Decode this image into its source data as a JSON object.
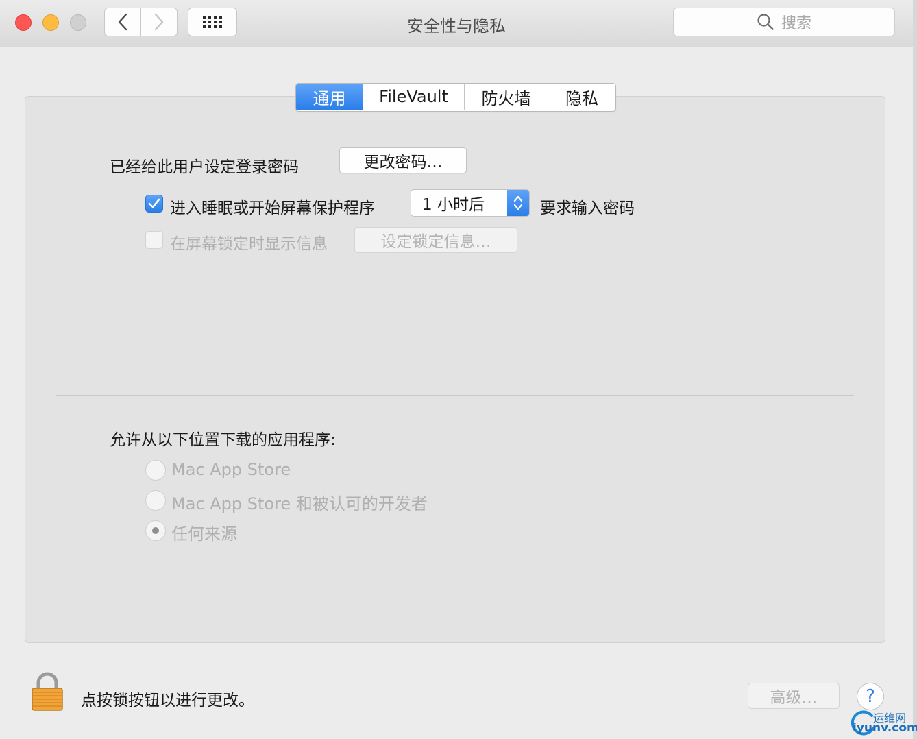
{
  "window": {
    "title": "安全性与隐私"
  },
  "toolbar": {
    "search_placeholder": "搜索"
  },
  "tabs": [
    {
      "label": "通用",
      "active": true
    },
    {
      "label": "FileVault",
      "active": false
    },
    {
      "label": "防火墙",
      "active": false
    },
    {
      "label": "隐私",
      "active": false
    }
  ],
  "general": {
    "password_label": "已经给此用户设定登录密码",
    "change_password_button": "更改密码…",
    "require_password": {
      "checked": true,
      "label_before": "进入睡眠或开始屏幕保护程序",
      "delay_value": "1 小时后",
      "label_after": "要求输入密码"
    },
    "lock_message": {
      "checked": false,
      "label": "在屏幕锁定时显示信息",
      "button": "设定锁定信息…"
    }
  },
  "downloads": {
    "heading": "允许从以下位置下载的应用程序:",
    "options": [
      {
        "label": "Mac App Store",
        "selected": false
      },
      {
        "label": "Mac App Store 和被认可的开发者",
        "selected": false
      },
      {
        "label": "任何来源",
        "selected": true
      }
    ]
  },
  "footer": {
    "lock_text": "点按锁按钮以进行更改。",
    "advanced_button": "高级…",
    "help_label": "?"
  },
  "watermark": {
    "top": "运维网",
    "bottom": "iyunv.com"
  },
  "colors": {
    "accent": "#2b7ee9",
    "close": "#fc5753",
    "minimize": "#fdbc40",
    "zoom_disabled": "#d0d0d0"
  }
}
